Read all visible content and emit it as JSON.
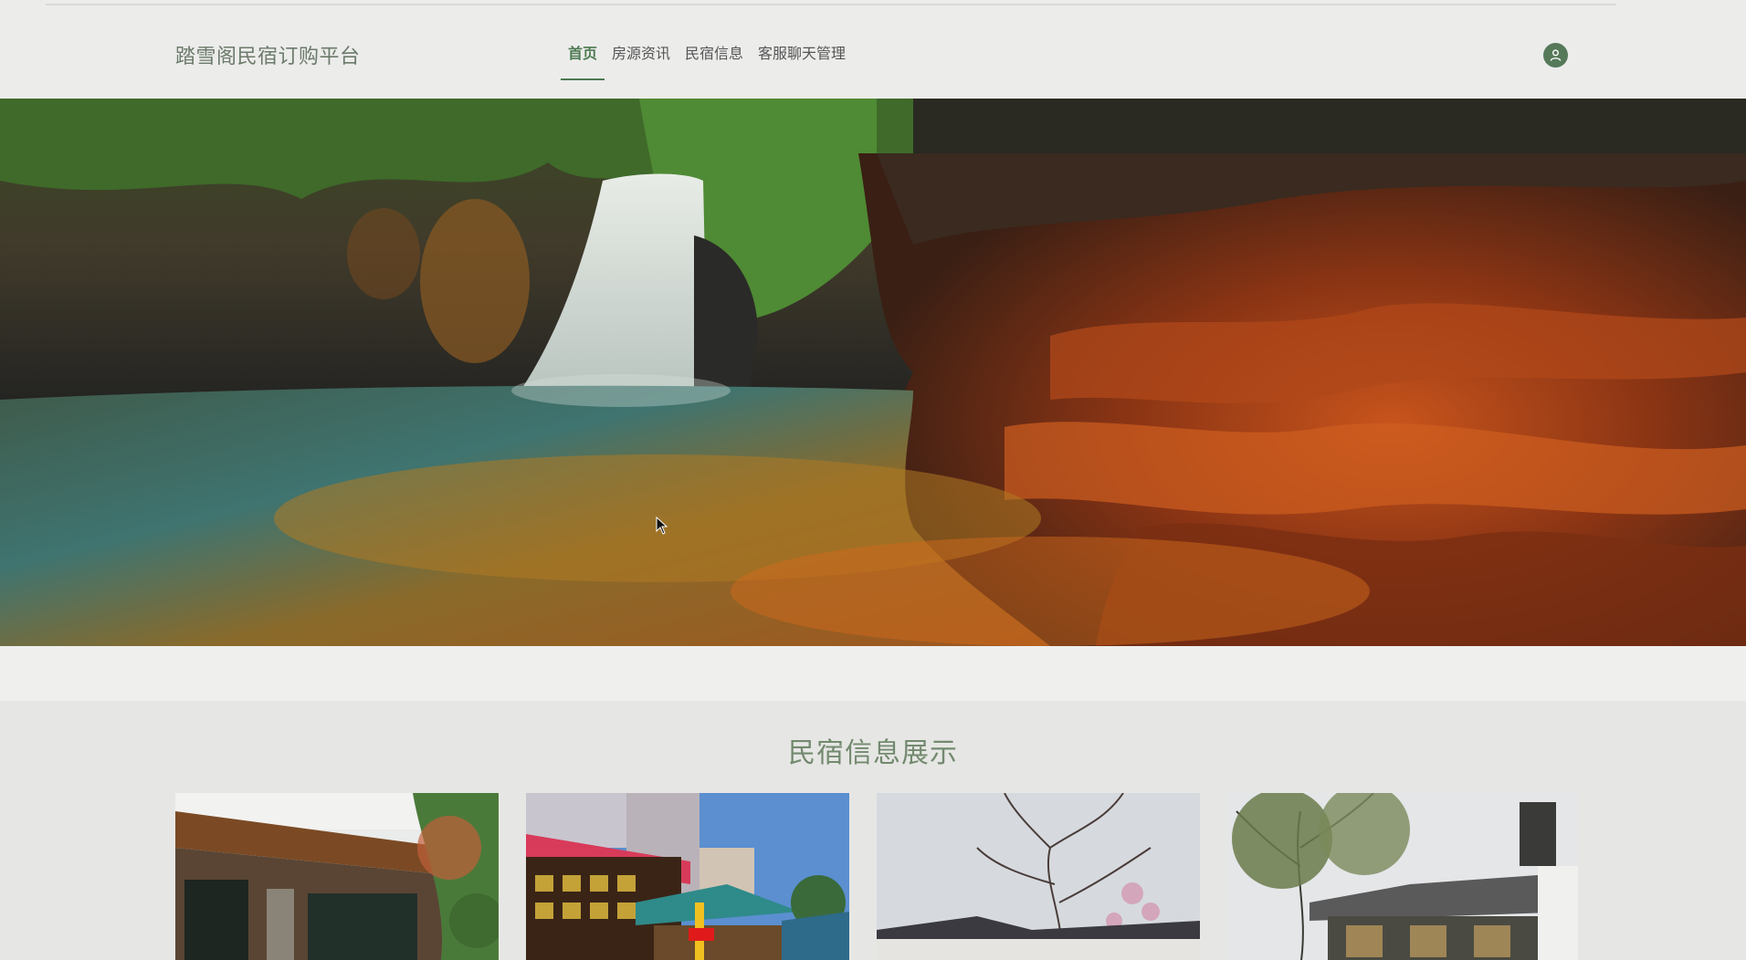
{
  "header": {
    "site_title": "踏雪阁民宿订购平台",
    "nav": [
      {
        "label": "首页",
        "active": true
      },
      {
        "label": "房源资讯",
        "active": false
      },
      {
        "label": "民宿信息",
        "active": false
      },
      {
        "label": "客服聊天管理",
        "active": false
      }
    ],
    "user_icon": "user-icon"
  },
  "banner": {
    "image": "waterfall-canyon-photo",
    "slides_count": 2,
    "active_slide": 1
  },
  "section": {
    "title": "民宿信息展示",
    "cards": [
      {
        "image": "wooden-house-photo"
      },
      {
        "image": "colorful-village-house-photo"
      },
      {
        "image": "blossom-tree-roof-photo"
      },
      {
        "image": "courtyard-pavilion-photo"
      }
    ]
  },
  "colors": {
    "accent": "#4d7a51",
    "title_gray_green": "#73896f",
    "active_dot": "#2f7ad8"
  }
}
